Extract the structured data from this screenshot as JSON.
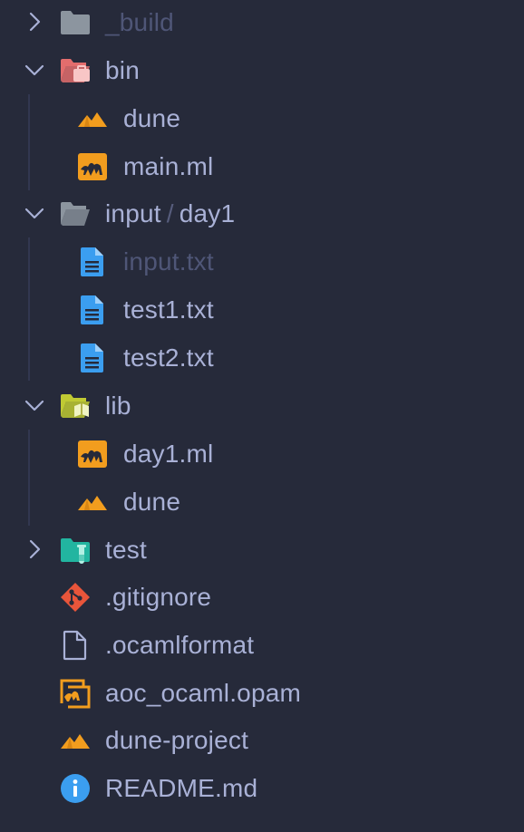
{
  "items": [
    {
      "label": "_build"
    },
    {
      "label": "bin"
    },
    {
      "label": "dune"
    },
    {
      "label": "main.ml"
    },
    {
      "label": "input",
      "separator": "/",
      "sub": "day1"
    },
    {
      "label": "input.txt"
    },
    {
      "label": "test1.txt"
    },
    {
      "label": "test2.txt"
    },
    {
      "label": "lib"
    },
    {
      "label": "day1.ml"
    },
    {
      "label": "dune"
    },
    {
      "label": "test"
    },
    {
      "label": ".gitignore"
    },
    {
      "label": ".ocamlformat"
    },
    {
      "label": "aoc_ocaml.opam"
    },
    {
      "label": "dune-project"
    },
    {
      "label": "README.md"
    }
  ],
  "colors": {
    "background": "#262a3a",
    "text": "#a9b1d6",
    "dimmed_text": "#4f5677",
    "ocaml_orange": "#f29d1e",
    "file_blue": "#3b9ef0",
    "git_red": "#e8553a",
    "bin_folder": "#e36d6d",
    "lib_folder": "#c0ca33",
    "test_folder": "#22b5a0",
    "info_blue": "#3b9ef0"
  },
  "icons": [
    "chevron-right-icon",
    "chevron-down-icon",
    "folder-icon",
    "folder-bin-icon",
    "dune-icon",
    "ocaml-icon",
    "folder-open-icon",
    "text-file-icon",
    "folder-lib-icon",
    "folder-test-icon",
    "git-icon",
    "file-icon",
    "opam-icon",
    "info-icon"
  ]
}
